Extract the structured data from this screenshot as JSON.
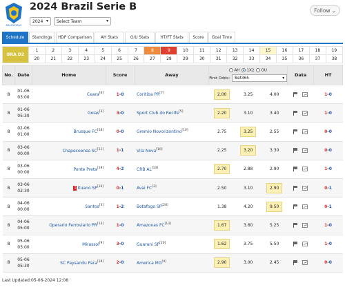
{
  "header": {
    "title": "2024 Brazil Serie B",
    "logo_text": "BRASILEIRÃO",
    "follow_label": "Follow",
    "season_select": "2024",
    "team_select": "Select Team"
  },
  "tabs": [
    "Schedule",
    "Standings",
    "HDP Comparison",
    "AH Stats",
    "O/U Stats",
    "HT/FT Stats",
    "Score",
    "Goal Time"
  ],
  "rounds": {
    "league_label": "BRA D2",
    "row1": [
      "1",
      "3",
      "5",
      "7",
      "9",
      "11",
      "13",
      "15",
      "17",
      "19",
      "21",
      "23",
      "25",
      "27",
      "29",
      "31",
      "33",
      "35",
      "37"
    ],
    "row2": [
      "2",
      "4",
      "6",
      "8",
      "10",
      "12",
      "14",
      "16",
      "18",
      "20",
      "22",
      "24",
      "26",
      "28",
      "30",
      "32",
      "34",
      "36",
      "38"
    ]
  },
  "table": {
    "headers": {
      "no": "No.",
      "date": "Date",
      "home": "Home",
      "score": "Score",
      "away": "Away",
      "data": "Data",
      "ht": "HT"
    },
    "odds_filter": {
      "ah": "AH",
      "x12": "1X2",
      "ou": "OU",
      "first_odds": "First Odds:",
      "bookmaker": "Bet365"
    },
    "rows": [
      {
        "no": "8",
        "date1": "01-06",
        "date2": "03:00",
        "home": "Ceara",
        "home_rank": "[6]",
        "sh": "1",
        "sa": "0",
        "away": "Coritiba PR",
        "away_rank": "[7]",
        "o1": "2.00",
        "ox": "3.25",
        "o2": "4.00",
        "hl": 1,
        "hth": "1",
        "hta": "0",
        "red": ""
      },
      {
        "no": "8",
        "date1": "01-06",
        "date2": "05:30",
        "home": "Goias",
        "home_rank": "[3]",
        "sh": "3",
        "sa": "0",
        "away": "Sport Club do Recife",
        "away_rank": "[5]",
        "o1": "2.20",
        "ox": "3.10",
        "o2": "3.40",
        "hl": 1,
        "hth": "1",
        "hta": "0",
        "red": ""
      },
      {
        "no": "8",
        "date1": "02-06",
        "date2": "01:00",
        "home": "Brusque FC",
        "home_rank": "[18]",
        "sh": "0",
        "sa": "0",
        "away": "Gremio Novorizontino",
        "away_rank": "[10]",
        "o1": "2.75",
        "ox": "3.25",
        "o2": "2.55",
        "hl": 2,
        "hth": "0",
        "hta": "0",
        "red": ""
      },
      {
        "no": "8",
        "date1": "03-06",
        "date2": "00:00",
        "home": "Chapecoense SC",
        "home_rank": "[11]",
        "sh": "1",
        "sa": "1",
        "away": "Vila Nova",
        "away_rank": "[10]",
        "o1": "2.25",
        "ox": "3.20",
        "o2": "3.30",
        "hl": 2,
        "hth": "0",
        "hta": "0",
        "red": ""
      },
      {
        "no": "8",
        "date1": "03-06",
        "date2": "00:00",
        "home": "Ponte Preta",
        "home_rank": "[19]",
        "sh": "4",
        "sa": "2",
        "away": "CRB AL",
        "away_rank": "[13]",
        "o1": "2.70",
        "ox": "2.88",
        "o2": "2.90",
        "hl": 1,
        "hth": "1",
        "hta": "0",
        "red": ""
      },
      {
        "no": "8",
        "date1": "03-06",
        "date2": "02:30",
        "home": "Ituano SP",
        "home_rank": "[16]",
        "sh": "0",
        "sa": "1",
        "away": "Avai FC",
        "away_rank": "[3]",
        "o1": "2.50",
        "ox": "3.10",
        "o2": "2.90",
        "hl": 3,
        "hth": "0",
        "hta": "1",
        "red": "1"
      },
      {
        "no": "8",
        "date1": "04-06",
        "date2": "00:00",
        "home": "Santos",
        "home_rank": "[3]",
        "sh": "1",
        "sa": "2",
        "away": "Botafogo SP",
        "away_rank": "[20]",
        "o1": "1.38",
        "ox": "4.20",
        "o2": "9.50",
        "hl": 3,
        "hth": "0",
        "hta": "1",
        "red": ""
      },
      {
        "no": "8",
        "date1": "04-06",
        "date2": "05:00",
        "home": "Operario Ferroviario PR",
        "home_rank": "[13]",
        "sh": "1",
        "sa": "0",
        "away": "Amazonas FC",
        "away_rank": "[13]",
        "o1": "1.67",
        "ox": "3.60",
        "o2": "5.25",
        "hl": 1,
        "hth": "1",
        "hta": "0",
        "red": ""
      },
      {
        "no": "8",
        "date1": "05-06",
        "date2": "03:00",
        "home": "Mirassol",
        "home_rank": "[9]",
        "sh": "3",
        "sa": "0",
        "away": "Guarani SP",
        "away_rank": "[20]",
        "o1": "1.62",
        "ox": "3.75",
        "o2": "5.50",
        "hl": 1,
        "hth": "1",
        "hta": "0",
        "red": ""
      },
      {
        "no": "8",
        "date1": "05-06",
        "date2": "05:30",
        "home": "SC Paysandu Para",
        "home_rank": "[19]",
        "sh": "2",
        "sa": "0",
        "away": "America MG",
        "away_rank": "[4]",
        "o1": "2.90",
        "ox": "3.00",
        "o2": "2.45",
        "hl": 1,
        "hth": "0",
        "hta": "0",
        "red": ""
      }
    ]
  },
  "footer": {
    "last_updated": "Last Updated:05-06-2024 12:08"
  },
  "colors": {
    "accent": "#1e74c6",
    "home_score": "#d62d2d",
    "away_score": "#1f53b3",
    "league_badge": "#d6c23f",
    "highlight_odds": "#fdf0b5"
  }
}
